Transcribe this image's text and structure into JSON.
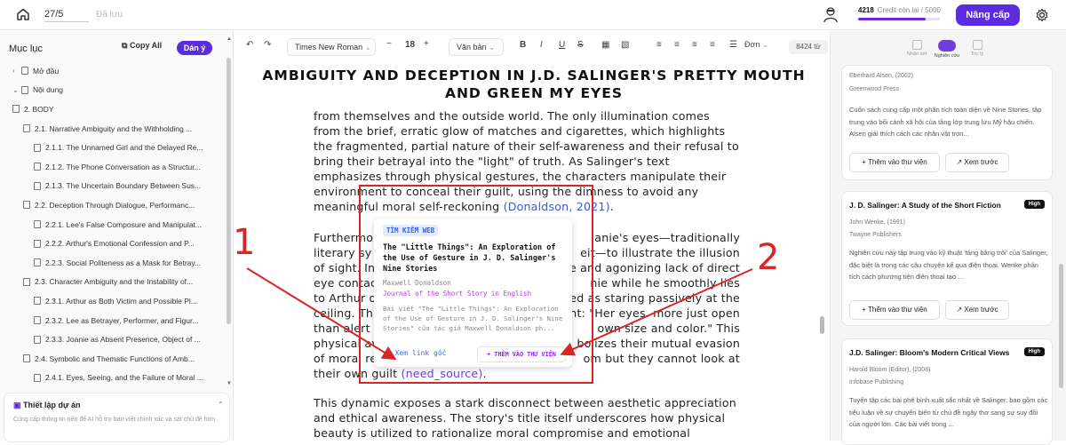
{
  "topbar": {
    "page_indicator": "27/5",
    "saved_label": "Đã lưu",
    "credit_value": "4218",
    "credit_label": "Credit còn lại",
    "credit_total": "/ 5000",
    "upgrade_label": "Nâng cấp"
  },
  "sidebar": {
    "title": "Mục lục",
    "copy_all": "Copy All",
    "paste": "Dán ý",
    "items": [
      {
        "label": "Mở đầu",
        "level": 0,
        "caret": "›",
        "icon": "page-icon"
      },
      {
        "label": "Nội dung",
        "level": 0,
        "caret": "⌄",
        "icon": "book-icon"
      },
      {
        "label": "2. BODY",
        "level": 1,
        "caret": "",
        "icon": "doc-icon"
      },
      {
        "label": "2.1. Narrative Ambiguity and the Withholding ...",
        "level": 2,
        "caret": "",
        "icon": "doc-icon"
      },
      {
        "label": "2.1.1. The Unnamed Girl and the Delayed Re...",
        "level": 3,
        "caret": "",
        "icon": "doc-icon"
      },
      {
        "label": "2.1.2. The Phone Conversation as a Structur...",
        "level": 3,
        "caret": "",
        "icon": "doc-icon"
      },
      {
        "label": "2.1.3. The Uncertain Boundary Between Sus...",
        "level": 3,
        "caret": "",
        "icon": "doc-icon"
      },
      {
        "label": "2.2. Deception Through Dialogue, Performanc...",
        "level": 2,
        "caret": "",
        "icon": "doc-icon"
      },
      {
        "label": "2.2.1. Lee's False Composure and Manipulat...",
        "level": 3,
        "caret": "",
        "icon": "doc-icon"
      },
      {
        "label": "2.2.2. Arthur's Emotional Confession and P...",
        "level": 3,
        "caret": "",
        "icon": "doc-icon"
      },
      {
        "label": "2.2.3. Social Politeness as a Mask for Betray...",
        "level": 3,
        "caret": "",
        "icon": "doc-icon"
      },
      {
        "label": "2.3. Character Ambiguity and the Instability of...",
        "level": 2,
        "caret": "",
        "icon": "doc-icon"
      },
      {
        "label": "2.3.1. Arthur as Both Victim and Possible Pl...",
        "level": 3,
        "caret": "",
        "icon": "doc-icon"
      },
      {
        "label": "2.3.2. Lee as Betrayer, Performer, and Figur...",
        "level": 3,
        "caret": "",
        "icon": "doc-icon"
      },
      {
        "label": "2.3.3. Joanie as Absent Presence, Object of ...",
        "level": 3,
        "caret": "",
        "icon": "doc-icon"
      },
      {
        "label": "2.4. Symbolic and Thematic Functions of Amb...",
        "level": 2,
        "caret": "",
        "icon": "doc-icon"
      },
      {
        "label": "2.4.1. Eyes, Seeing, and the Failure of Moral ...",
        "level": 3,
        "caret": "",
        "icon": "doc-icon"
      },
      {
        "label": "2.4.2. The Title Phrase and the Conflict Betw...",
        "level": 3,
        "caret": "",
        "icon": "doc-icon"
      }
    ],
    "setup_title": "Thiết lập dự án",
    "setup_desc": "Cung cấp thông tin nền để AI hỗ trợ bạn viết chính xác và sát chủ đề hơn"
  },
  "toolbar": {
    "font": "Times New Roman",
    "font_size": "18",
    "style": "Văn bản",
    "spacing": "Đơn",
    "word_count": "8424 từ"
  },
  "document": {
    "title": "AMBIGUITY AND DECEPTION IN J.D. SALINGER'S PRETTY MOUTH AND GREEN MY EYES",
    "p1": "from themselves and the outside world. The only illumination comes from the brief, erratic glow of matches and cigarettes, which highlights the fragmented, partial nature of their self-awareness and their refusal to bring their betrayal into the \"light\" of truth. As Salinger's text emphasizes through physical gestures, the characters manipulate their environment to conceal their guilt, using the dimness to avoid any meaningful moral self-reckoning",
    "p1_cite": "(Donaldson, 2021)",
    "p2_lines": [
      "Furthermo",
      "literary sy",
      "of sight. In",
      "eye contac",
      "to Arthur o",
      "ceiling. Th",
      "than alert c",
      "physical av",
      "of moral re"
    ],
    "p2_right": [
      "anie's eyes—traditionally",
      "eit—to illustrate the illusion",
      "e and agonizing lack of direct",
      "nie while he smoothly lies",
      "ed as staring passively at the",
      "nt: \"Her eyes. more just open",
      "own size and color.\" This",
      "bolizes their mutual evasion",
      "om but they cannot look at"
    ],
    "p2_end": "their own guilt",
    "p2_cite": "(need_source)",
    "p3": "This dynamic exposes a stark disconnect between aesthetic appreciation and ethical awareness. The story's title itself underscores how physical beauty is utilized to rationalize moral compromise and emotional vacancy."
  },
  "popup": {
    "tag": "TÌM KIẾM WEB",
    "title": "The \"Little Things\": An Exploration of the Use of Gesture in J. D. Salinger's Nine Stories",
    "author": "Maxwell Donaldson",
    "journal": "Journal of the Short Story in English",
    "description": "Bài viết \"The \"Little Things\": An Exploration of the Use of Gesture in J. D. Salinger's Nine Stories\" của tác giả Maxwell Donaldson ph...",
    "link_label": "Xem link gốc",
    "add_label": "+ THÊM VÀO THƯ VIỆN"
  },
  "annotations": {
    "label1": "1",
    "label2": "2",
    "color": "#d82626"
  },
  "right_panel": {
    "tabs": [
      "Nhận xét",
      "Nghiên cứu",
      "Trợ lý"
    ],
    "active_tab": "Nghiên cứu",
    "cards": [
      {
        "title": "",
        "badge": "",
        "author": "Eberhard Alsen, (2002)",
        "publisher": "Greenwood Press",
        "description": "Cuốn sách cung cấp một phân tích toàn diện về Nine Stories, tập trung vào bối cảnh xã hội của tầng lớp trung lưu Mỹ hậu chiến. Alsen giải thích cách các nhân vật tron...",
        "add_label": "+ Thêm vào thư viện",
        "preview_label": "Xem trước"
      },
      {
        "title": "J. D. Salinger: A Study of the Short Fiction",
        "badge": "High",
        "author": "John Wenke, (1991)",
        "publisher": "Twayne Publishers",
        "description": "Nghiên cứu này tập trung vào kỹ thuật 'tảng băng trôi' của Salinger, đặc biệt là trong các câu chuyện kể qua điện thoại. Wenke phân tích cách phương tiện điện thoại tạo ...",
        "add_label": "+ Thêm vào thư viện",
        "preview_label": "Xem trước"
      },
      {
        "title": "J.D. Salinger: Bloom's Modern Critical Views",
        "badge": "High",
        "author": "Harold Bloom (Editor), (2008)",
        "publisher": "Infobase Publishing",
        "description": "Tuyển tập các bài phê bình xuất sắc nhất về Salinger, bao gồm các tiểu luận về sự chuyển biến từ chủ đề ngây thơ sang sự suy đồi của người lớn. Các bài viết trong ...",
        "add_label": "",
        "preview_label": ""
      }
    ]
  }
}
